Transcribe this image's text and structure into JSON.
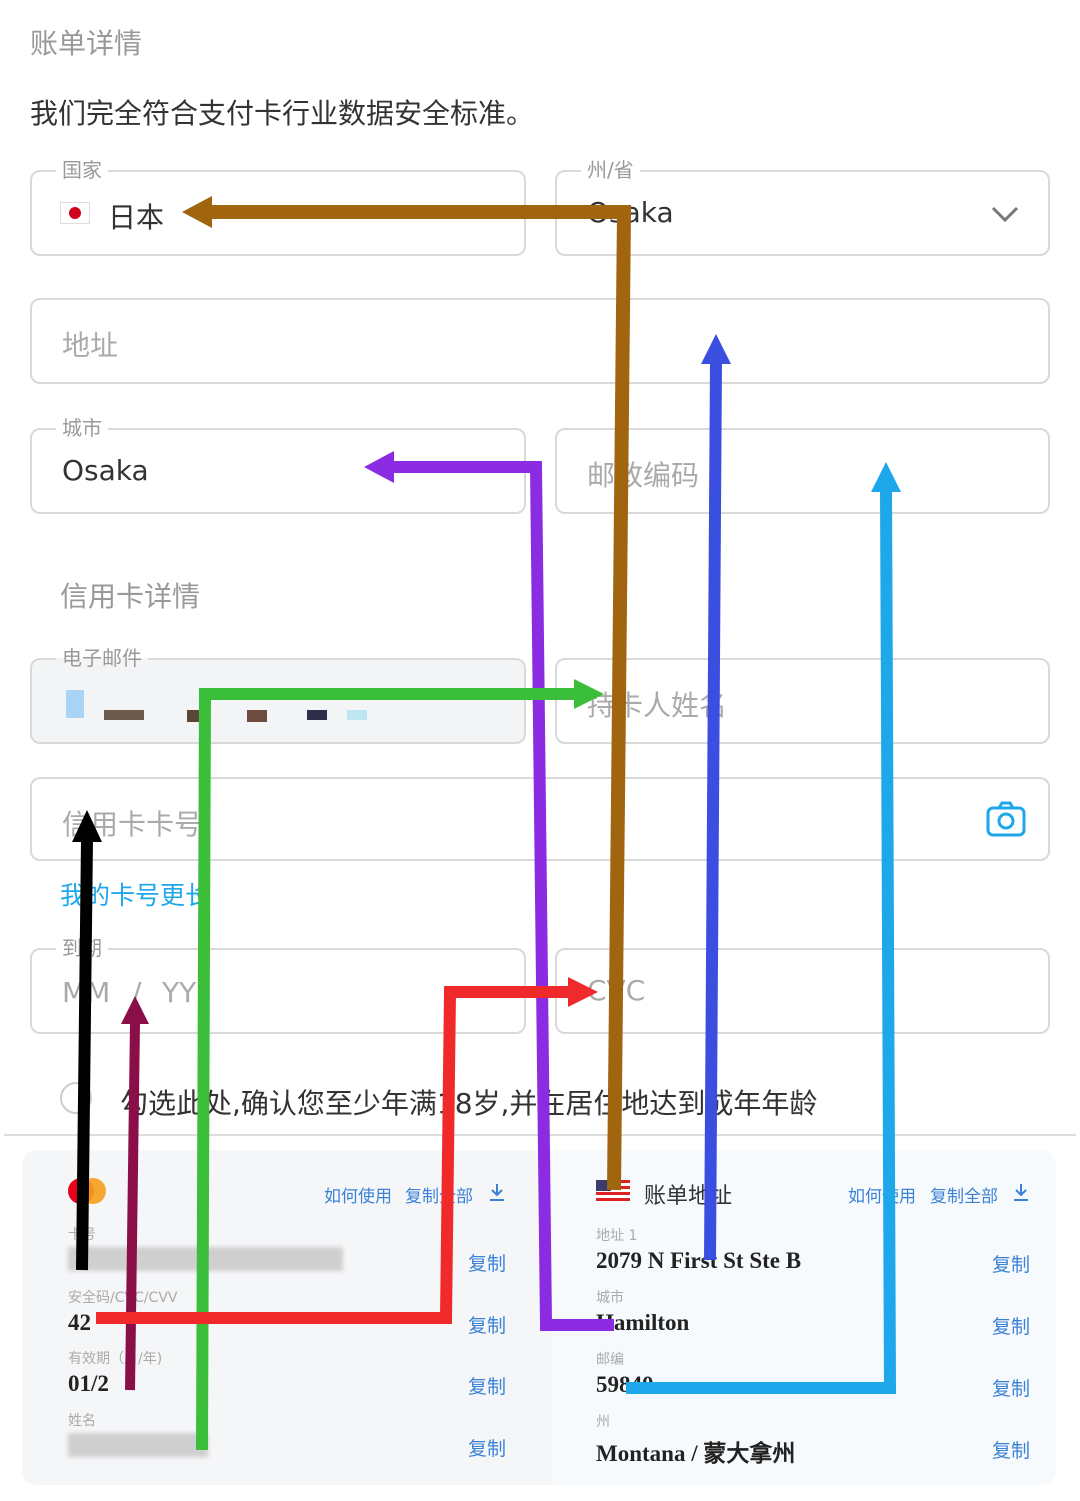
{
  "billing": {
    "title": "账单详情",
    "compliance": "我们完全符合支付卡行业数据安全标准。",
    "country": {
      "label": "国家",
      "value": "日本"
    },
    "state": {
      "label": "州/省",
      "value": "Osaka"
    },
    "address": {
      "placeholder": "地址"
    },
    "city": {
      "label": "城市",
      "value": "Osaka"
    },
    "zip": {
      "placeholder": "邮政编码"
    }
  },
  "card": {
    "title": "信用卡详情",
    "email": {
      "label": "电子邮件"
    },
    "holder": {
      "placeholder": "持卡人姓名"
    },
    "number": {
      "placeholder": "信用卡卡号"
    },
    "longer_link": "我的卡号更长",
    "expiry": {
      "label": "到期",
      "mm": "MM",
      "slash": "/",
      "yy": "YY"
    },
    "cvc": {
      "placeholder": "CVC"
    },
    "age_confirm": "勾选此处,确认您至少年满18岁,并在居住地达到成年年龄"
  },
  "left_panel": {
    "how_to_use": "如何使用",
    "copy_all": "复制全部",
    "fields": [
      {
        "label": "卡号",
        "value": "",
        "copy": "复制"
      },
      {
        "label": "安全码/CVC/CVV",
        "value": "42",
        "copy": "复制"
      },
      {
        "label": "有效期（月/年)",
        "value": "01/2",
        "copy": "复制"
      },
      {
        "label": "姓名",
        "value": "",
        "copy": "复制"
      }
    ]
  },
  "right_panel": {
    "title": "账单地址",
    "how_to_use": "如何使用",
    "copy_all": "复制全部",
    "fields": [
      {
        "label": "地址 1",
        "value": "2079 N First St Ste B",
        "copy": "复制"
      },
      {
        "label": "城市",
        "value": "Hamilton",
        "copy": "复制"
      },
      {
        "label": "邮编",
        "value": "59840",
        "copy": "复制"
      },
      {
        "label": "州",
        "value": "Montana / 蒙大拿州",
        "copy": "复制"
      }
    ]
  },
  "icons": {
    "japan_flag": "japan-flag-icon",
    "us_flag": "us-flag-icon",
    "chevron": "chevron-down-icon",
    "camera": "camera-icon",
    "download": "download-icon",
    "card_brand": "mastercard-icon"
  },
  "colors": {
    "arrow_brown": "#a0650e",
    "arrow_purple": "#8b2be2",
    "arrow_blue": "#3a4fe0",
    "arrow_lightblue": "#1ea7ea",
    "arrow_green": "#3bbf3b",
    "arrow_black": "#000000",
    "arrow_maroon": "#8a0f48",
    "arrow_red": "#f02a2a",
    "link": "#3b82d6"
  }
}
